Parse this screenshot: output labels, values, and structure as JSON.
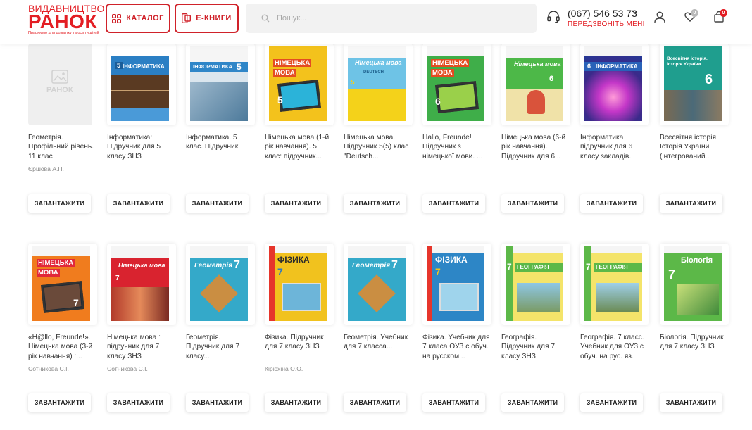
{
  "header": {
    "logo_line1": "ВИДАВНИЦТВО",
    "logo_line2": "РАНОК",
    "logo_tagline": "Працюємо для розвитку та освіти дітей",
    "catalog_label": "КАТАЛОГ",
    "ebooks_label": "Е-КНИГИ",
    "search_placeholder": "Пошук...",
    "phone": "(067) 546 53 73",
    "callback_label": "ПЕРЕДЗВОНІТЬ МЕНІ",
    "wishlist_count": "0",
    "cart_count": "0"
  },
  "download_label": "ЗАВАНТАЖИТИ",
  "products": [
    {
      "title": "Геометрія. Профільний рівень. 11 клас",
      "author": "Єршова А.П."
    },
    {
      "title": "Інформатика: Підручник для 5 класу ЗНЗ",
      "author": ""
    },
    {
      "title": "Інформатика. 5 клас. Підручник",
      "author": ""
    },
    {
      "title": "Німецька мова (1-й рік навчання). 5 клас: підручник...",
      "author": ""
    },
    {
      "title": "Німецька мова. Підручник 5(5) клас \"Deutsch...",
      "author": ""
    },
    {
      "title": "Hallo, Freunde! Підручник з німецької мови. ...",
      "author": ""
    },
    {
      "title": "Німецька мова (6-й рік навчання). Підручник для 6...",
      "author": ""
    },
    {
      "title": "Інформатика підручник для 6 класу закладів...",
      "author": ""
    },
    {
      "title": "Всесвітня історія. Історія України (інтегрований...",
      "author": ""
    },
    {
      "title": "«H@llo, Freunde!». Німецька мова (3-й рік навчання) :...",
      "author": "Сотникова С.І."
    },
    {
      "title": "Німецька мова : підручник для 7 класу ЗНЗ",
      "author": "Сотникова С.І."
    },
    {
      "title": "Геометрія. Підручник для 7 класу...",
      "author": ""
    },
    {
      "title": "Фізика. Підручник для 7 класу ЗНЗ",
      "author": "Кірюхіна О.О."
    },
    {
      "title": "Геометрія. Учебник для 7 класса...",
      "author": ""
    },
    {
      "title": "Фізика. Учебник для 7 класа ОУЗ с обуч. на русском...",
      "author": ""
    },
    {
      "title": "Географія. Підручник для 7 класу ЗНЗ",
      "author": ""
    },
    {
      "title": "Географія. 7 класс. Учебник для ОУЗ с обуч. на рус. яз.",
      "author": ""
    },
    {
      "title": "Біологія. Підручник для 7 класу ЗНЗ",
      "author": ""
    }
  ],
  "covers": {
    "placeholder_text": "РАНОК",
    "informatika": "ІНФОРМАТИКА",
    "nimetska": "НІМЕЦЬКА",
    "mova": "МОВА",
    "nimetska_mova_script": "Німецька мова",
    "deutsch": "DEUTSCH",
    "istoriia": "Всесвітня історія. Історія України",
    "geometriia": "Геометрія",
    "fizyka": "ФІЗИКА",
    "heohrafiia": "ГЕОГРАФІЯ",
    "biolohiia": "Біологія",
    "grade5": "5",
    "grade6": "6",
    "grade7": "7"
  },
  "colors": {
    "brand_red": "#e31e24",
    "button_border": "#d0222a"
  }
}
